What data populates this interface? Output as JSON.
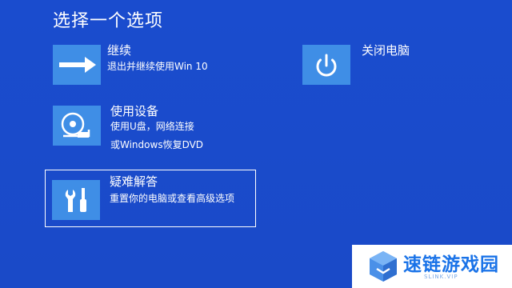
{
  "screen_title": "选择一个选项",
  "options": {
    "continue": {
      "title": "继续",
      "desc1": "退出并继续使用Win 10",
      "icon": "arrow-right-icon"
    },
    "shutdown": {
      "title": "关闭电脑",
      "icon": "power-icon"
    },
    "use_device": {
      "title": "使用设备",
      "desc1": "使用U盘，网络连接",
      "desc2": "或Windows恢复DVD",
      "icon": "disc-drive-icon"
    },
    "troubleshoot": {
      "title": "疑难解答",
      "desc1": "重置你的电脑或查看高级选项",
      "icon": "tools-icon"
    }
  },
  "watermark": {
    "name": "速链游戏园",
    "url": "SLINK.VIP"
  },
  "colors": {
    "background": "#1d4ed0",
    "tile": "#3f8ee6",
    "text": "#ffffff"
  }
}
